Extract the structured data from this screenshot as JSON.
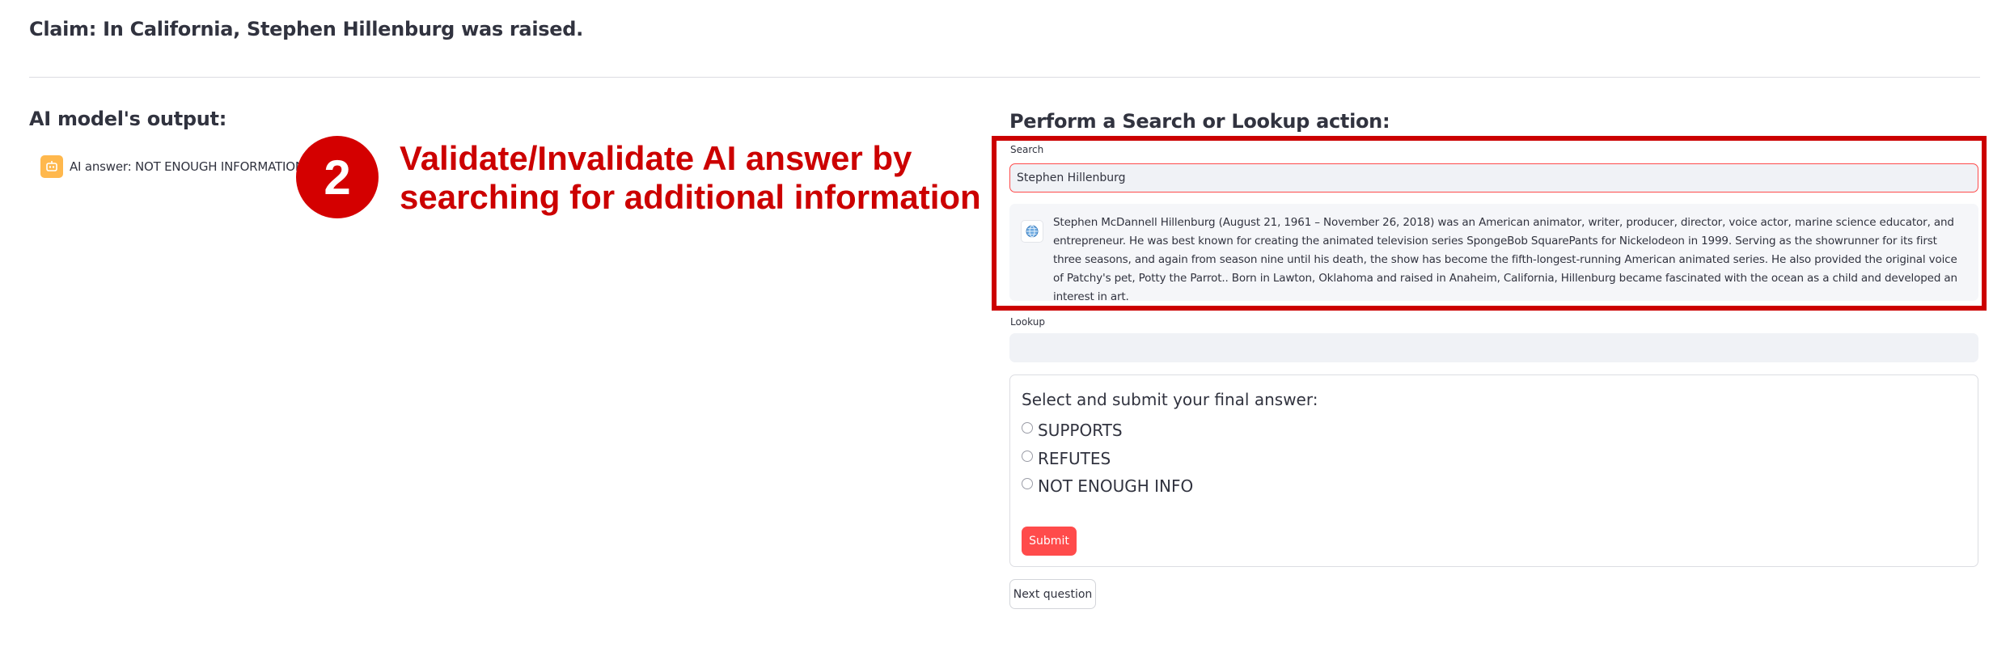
{
  "claim": "Claim: In California, Stephen Hillenburg was raised.",
  "ai_output": {
    "title": "AI model's output:",
    "answer": "AI answer: NOT ENOUGH INFORMATION",
    "avatar_icon": "robot-icon"
  },
  "annotation": {
    "step_number": "2",
    "text": "Validate/Invalidate AI answer by searching for additional information",
    "color": "#cc0000"
  },
  "action": {
    "title": "Perform a Search or Lookup action:",
    "search_label": "Search",
    "search_value": "Stephen Hillenburg",
    "search_result": "Stephen McDannell Hillenburg (August 21, 1961 – November 26, 2018) was an American animator, writer, producer, director, voice actor, marine science educator, and entrepreneur. He was best known for creating the animated television series SpongeBob SquarePants for Nickelodeon in 1999. Serving as the showrunner for its first three seasons, and again from season nine until his death, the show has become the fifth-longest-running American animated series. He also provided the original voice of Patchy's pet, Potty the Parrot.. Born in Lawton, Oklahoma and raised in Anaheim, California, Hillenburg became fascinated with the ocean as a child and developed an interest in art.",
    "result_icon": "globe-icon",
    "lookup_label": "Lookup",
    "lookup_value": ""
  },
  "form": {
    "title": "Select and submit your final answer:",
    "options": [
      "SUPPORTS",
      "REFUTES",
      "NOT ENOUGH INFO"
    ],
    "submit_label": "Submit"
  },
  "next_label": "Next question",
  "colors": {
    "accent": "#ff4b4b",
    "annotation_red": "#cc0000",
    "avatar": "#ffb84d"
  }
}
